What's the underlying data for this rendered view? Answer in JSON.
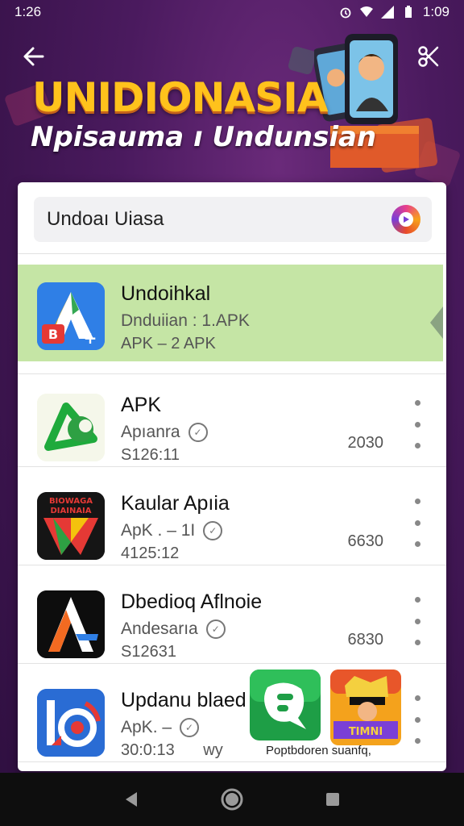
{
  "status_bar": {
    "time": "1:26",
    "clock_right": "1:09"
  },
  "banner": {
    "title": "UNIDIONASIA",
    "subtitle": "Npisauma ı Undunsian"
  },
  "search": {
    "value": "Undoaı Uiasa"
  },
  "apps": [
    {
      "title": "Undoihkal",
      "line2": "Dnduiian : 1.APK",
      "line3": "APK – 2 APK",
      "size": "",
      "selected": true
    },
    {
      "title": "APK",
      "line2": "Apıanra",
      "line3": "S126:11",
      "size": "2030"
    },
    {
      "title": "Kaular Apıia",
      "line2": "ApK . – 1I",
      "line3": "4125:12",
      "size": "6630"
    },
    {
      "title": "Dbedioq Aflnoie",
      "line2": "Andesarıa",
      "line3": "S12631",
      "size": "6830"
    },
    {
      "title": "Updanu blaed",
      "line2": "ApK. –",
      "line3": "30:0:13",
      "line3_suffix": "wy",
      "size": ""
    }
  ],
  "popup": {
    "caption": "Poptbdoren suanfq,"
  },
  "icon_art": {
    "app1": "logo-letter-a-icon",
    "app2": "green-leaf-logo-icon",
    "app3": "flag-logo-icon",
    "app4": "letter-a-logo-icon",
    "app5": "camera-logo-icon"
  },
  "colors": {
    "banner_title": "#ffc21c",
    "selected_row": "#c5e5a5",
    "background": "#4a1a5e"
  }
}
